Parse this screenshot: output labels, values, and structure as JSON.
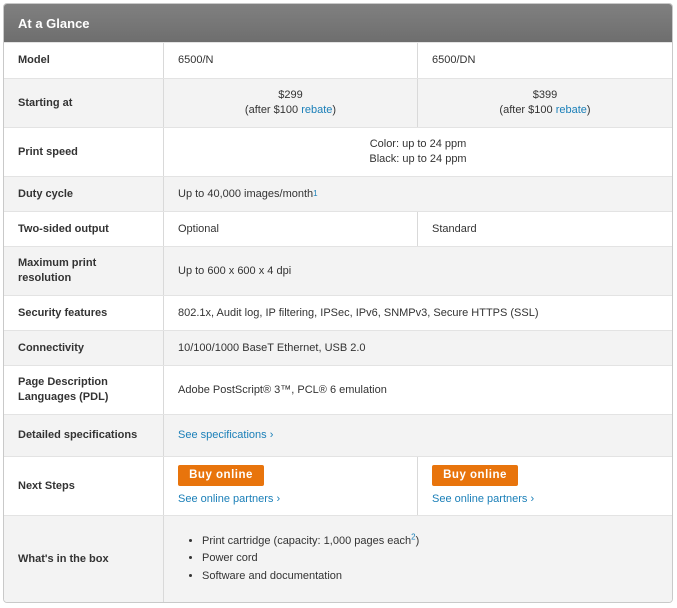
{
  "title": "At a Glance",
  "rows": {
    "model": {
      "label": "Model",
      "col1": "6500/N",
      "col2": "6500/DN"
    },
    "starting_at": {
      "label": "Starting at",
      "col1_price": "$299",
      "col1_after_pre": "(after $100 ",
      "col1_after_link": "rebate",
      "col1_after_post": ")",
      "col2_price": "$399",
      "col2_after_pre": "(after $100 ",
      "col2_after_link": "rebate",
      "col2_after_post": ")"
    },
    "print_speed": {
      "label": "Print speed",
      "line1": "Color: up to 24 ppm",
      "line2": "Black: up to 24 ppm"
    },
    "duty_cycle": {
      "label": "Duty cycle",
      "value": "Up to 40,000 images/month",
      "footnote": "1"
    },
    "two_sided": {
      "label": "Two-sided output",
      "col1": "Optional",
      "col2": "Standard"
    },
    "max_res": {
      "label_line1": "Maximum print",
      "label_line2": "resolution",
      "value": "Up to 600 x 600 x 4 dpi"
    },
    "security": {
      "label": "Security features",
      "value": "802.1x, Audit log, IP filtering, IPSec, IPv6, SNMPv3, Secure HTTPS (SSL)"
    },
    "connectivity": {
      "label": "Connectivity",
      "value": "10/100/1000 BaseT Ethernet, USB 2.0"
    },
    "pdl": {
      "label_line1": "Page Description",
      "label_line2": "Languages (PDL)",
      "value": "Adobe PostScript® 3™, PCL® 6 emulation"
    },
    "detailed_specs": {
      "label": "Detailed specifications",
      "link": "See specifications ›"
    },
    "next_steps": {
      "label": "Next Steps",
      "buy_label": "Buy online",
      "partners_link": "See online partners ›"
    },
    "in_box": {
      "label": "What's in the box",
      "items": [
        "Print cartridge (capacity: 1,000 pages each",
        "Power cord",
        "Software and documentation"
      ],
      "item1_footnote": "2",
      "item1_post": ")"
    }
  },
  "colors": {
    "accent": "#e8740c",
    "link": "#1a7fb8",
    "header": "#7a7a7a"
  }
}
